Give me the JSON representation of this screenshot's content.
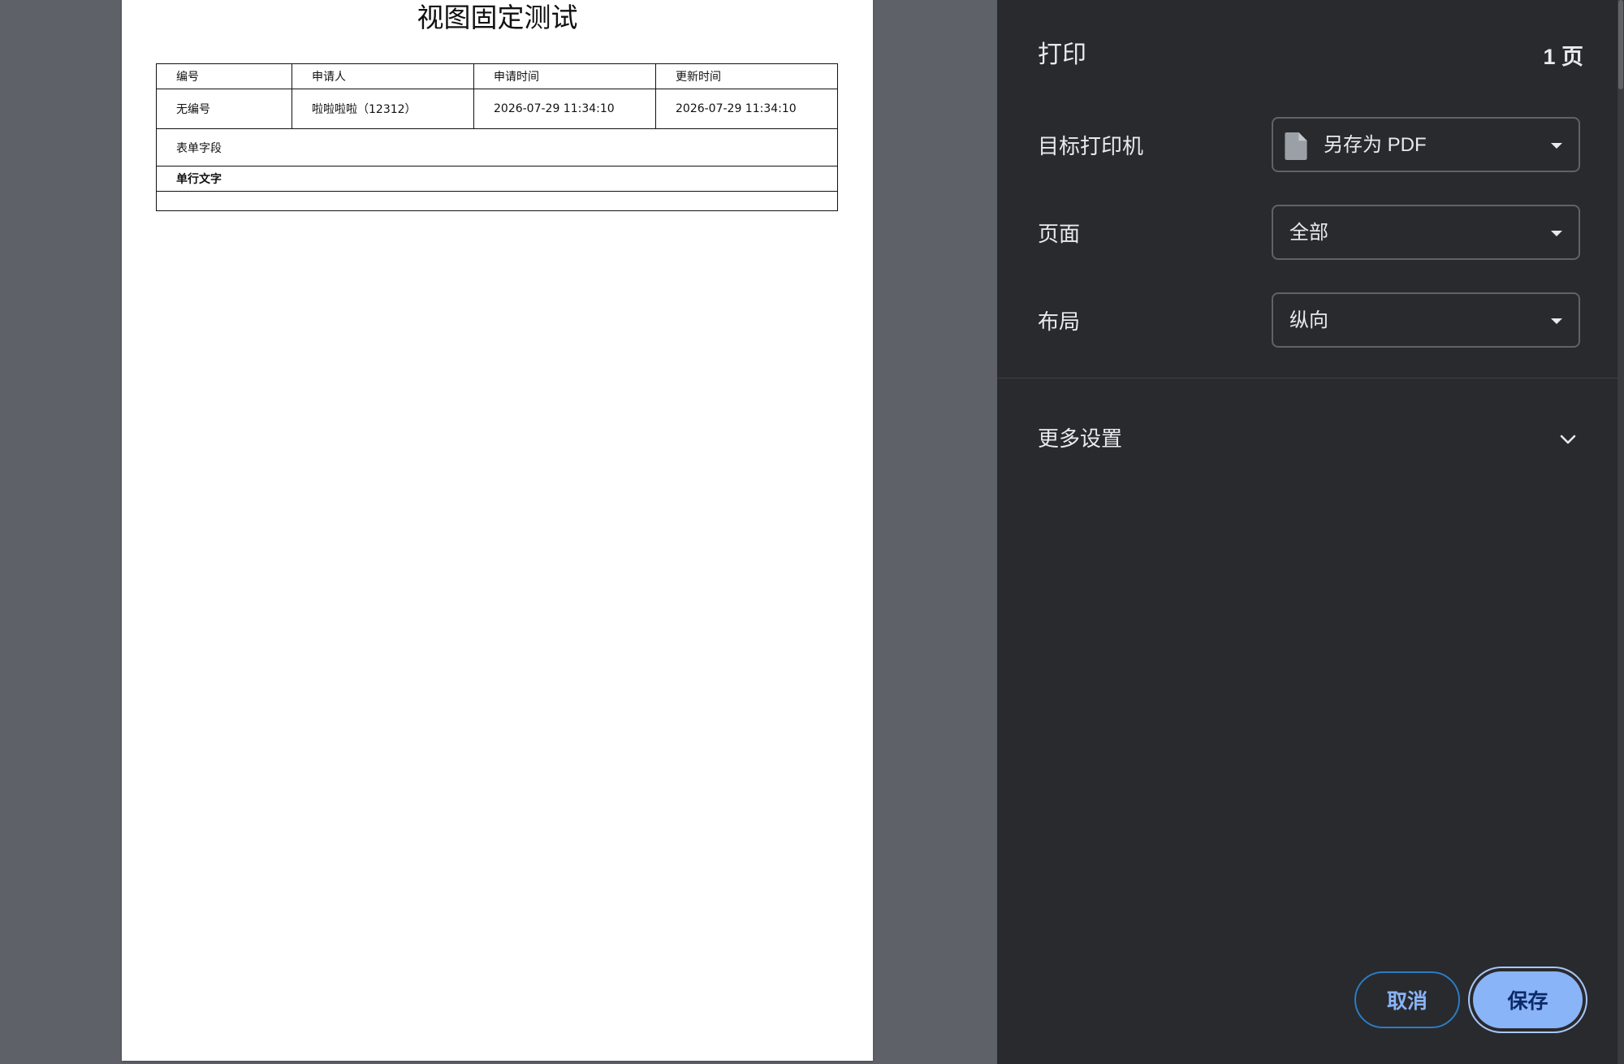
{
  "document": {
    "title": "视图固定测试",
    "table": {
      "headers": [
        "编号",
        "申请人",
        "申请时间",
        "更新时间"
      ],
      "values": [
        "无编号",
        "啦啦啦啦（12312）",
        "2026-07-29 11:34:10",
        "2026-07-29 11:34:10"
      ],
      "section_label": "表单字段",
      "field_label": "单行文字",
      "field_value": ""
    }
  },
  "panel": {
    "title": "打印",
    "page_count": "1 页",
    "destination": {
      "label": "目标打印机",
      "value": "另存为 PDF",
      "icon": "file-icon"
    },
    "pages": {
      "label": "页面",
      "value": "全部"
    },
    "layout": {
      "label": "布局",
      "value": "纵向"
    },
    "more_settings": {
      "label": "更多设置",
      "icon": "chevron-down-icon"
    },
    "buttons": {
      "cancel": "取消",
      "save": "保存"
    }
  },
  "colors": {
    "preview_background": "#5f6169",
    "panel_background": "#292a2d",
    "accent": "#8ab4f8",
    "panel_text": "#e8eaed"
  }
}
